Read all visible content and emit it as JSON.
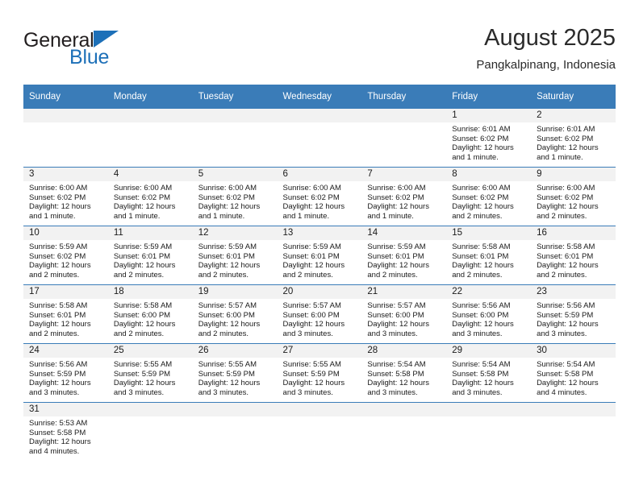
{
  "logo": {
    "word_primary": "General",
    "word_secondary": "Blue",
    "flag_icon": "triangle-flag-icon",
    "primary_color": "#231f20",
    "accent_color": "#1d70b8"
  },
  "header": {
    "title": "August 2025",
    "subtitle": "Pangkalpinang, Indonesia"
  },
  "theme": {
    "header_bg": "#3a7cb8",
    "header_text": "#ffffff",
    "daynum_band_bg": "#f2f2f2",
    "row_divider": "#3a7cb8",
    "body_text": "#1a1a1a"
  },
  "calendar": {
    "weekday_headers": [
      "Sunday",
      "Monday",
      "Tuesday",
      "Wednesday",
      "Thursday",
      "Friday",
      "Saturday"
    ],
    "weeks": [
      [
        {
          "day": "",
          "lines": []
        },
        {
          "day": "",
          "lines": []
        },
        {
          "day": "",
          "lines": []
        },
        {
          "day": "",
          "lines": []
        },
        {
          "day": "",
          "lines": []
        },
        {
          "day": "1",
          "lines": [
            "Sunrise: 6:01 AM",
            "Sunset: 6:02 PM",
            "Daylight: 12 hours",
            "and 1 minute."
          ]
        },
        {
          "day": "2",
          "lines": [
            "Sunrise: 6:01 AM",
            "Sunset: 6:02 PM",
            "Daylight: 12 hours",
            "and 1 minute."
          ]
        }
      ],
      [
        {
          "day": "3",
          "lines": [
            "Sunrise: 6:00 AM",
            "Sunset: 6:02 PM",
            "Daylight: 12 hours",
            "and 1 minute."
          ]
        },
        {
          "day": "4",
          "lines": [
            "Sunrise: 6:00 AM",
            "Sunset: 6:02 PM",
            "Daylight: 12 hours",
            "and 1 minute."
          ]
        },
        {
          "day": "5",
          "lines": [
            "Sunrise: 6:00 AM",
            "Sunset: 6:02 PM",
            "Daylight: 12 hours",
            "and 1 minute."
          ]
        },
        {
          "day": "6",
          "lines": [
            "Sunrise: 6:00 AM",
            "Sunset: 6:02 PM",
            "Daylight: 12 hours",
            "and 1 minute."
          ]
        },
        {
          "day": "7",
          "lines": [
            "Sunrise: 6:00 AM",
            "Sunset: 6:02 PM",
            "Daylight: 12 hours",
            "and 1 minute."
          ]
        },
        {
          "day": "8",
          "lines": [
            "Sunrise: 6:00 AM",
            "Sunset: 6:02 PM",
            "Daylight: 12 hours",
            "and 2 minutes."
          ]
        },
        {
          "day": "9",
          "lines": [
            "Sunrise: 6:00 AM",
            "Sunset: 6:02 PM",
            "Daylight: 12 hours",
            "and 2 minutes."
          ]
        }
      ],
      [
        {
          "day": "10",
          "lines": [
            "Sunrise: 5:59 AM",
            "Sunset: 6:02 PM",
            "Daylight: 12 hours",
            "and 2 minutes."
          ]
        },
        {
          "day": "11",
          "lines": [
            "Sunrise: 5:59 AM",
            "Sunset: 6:01 PM",
            "Daylight: 12 hours",
            "and 2 minutes."
          ]
        },
        {
          "day": "12",
          "lines": [
            "Sunrise: 5:59 AM",
            "Sunset: 6:01 PM",
            "Daylight: 12 hours",
            "and 2 minutes."
          ]
        },
        {
          "day": "13",
          "lines": [
            "Sunrise: 5:59 AM",
            "Sunset: 6:01 PM",
            "Daylight: 12 hours",
            "and 2 minutes."
          ]
        },
        {
          "day": "14",
          "lines": [
            "Sunrise: 5:59 AM",
            "Sunset: 6:01 PM",
            "Daylight: 12 hours",
            "and 2 minutes."
          ]
        },
        {
          "day": "15",
          "lines": [
            "Sunrise: 5:58 AM",
            "Sunset: 6:01 PM",
            "Daylight: 12 hours",
            "and 2 minutes."
          ]
        },
        {
          "day": "16",
          "lines": [
            "Sunrise: 5:58 AM",
            "Sunset: 6:01 PM",
            "Daylight: 12 hours",
            "and 2 minutes."
          ]
        }
      ],
      [
        {
          "day": "17",
          "lines": [
            "Sunrise: 5:58 AM",
            "Sunset: 6:01 PM",
            "Daylight: 12 hours",
            "and 2 minutes."
          ]
        },
        {
          "day": "18",
          "lines": [
            "Sunrise: 5:58 AM",
            "Sunset: 6:00 PM",
            "Daylight: 12 hours",
            "and 2 minutes."
          ]
        },
        {
          "day": "19",
          "lines": [
            "Sunrise: 5:57 AM",
            "Sunset: 6:00 PM",
            "Daylight: 12 hours",
            "and 2 minutes."
          ]
        },
        {
          "day": "20",
          "lines": [
            "Sunrise: 5:57 AM",
            "Sunset: 6:00 PM",
            "Daylight: 12 hours",
            "and 3 minutes."
          ]
        },
        {
          "day": "21",
          "lines": [
            "Sunrise: 5:57 AM",
            "Sunset: 6:00 PM",
            "Daylight: 12 hours",
            "and 3 minutes."
          ]
        },
        {
          "day": "22",
          "lines": [
            "Sunrise: 5:56 AM",
            "Sunset: 6:00 PM",
            "Daylight: 12 hours",
            "and 3 minutes."
          ]
        },
        {
          "day": "23",
          "lines": [
            "Sunrise: 5:56 AM",
            "Sunset: 5:59 PM",
            "Daylight: 12 hours",
            "and 3 minutes."
          ]
        }
      ],
      [
        {
          "day": "24",
          "lines": [
            "Sunrise: 5:56 AM",
            "Sunset: 5:59 PM",
            "Daylight: 12 hours",
            "and 3 minutes."
          ]
        },
        {
          "day": "25",
          "lines": [
            "Sunrise: 5:55 AM",
            "Sunset: 5:59 PM",
            "Daylight: 12 hours",
            "and 3 minutes."
          ]
        },
        {
          "day": "26",
          "lines": [
            "Sunrise: 5:55 AM",
            "Sunset: 5:59 PM",
            "Daylight: 12 hours",
            "and 3 minutes."
          ]
        },
        {
          "day": "27",
          "lines": [
            "Sunrise: 5:55 AM",
            "Sunset: 5:59 PM",
            "Daylight: 12 hours",
            "and 3 minutes."
          ]
        },
        {
          "day": "28",
          "lines": [
            "Sunrise: 5:54 AM",
            "Sunset: 5:58 PM",
            "Daylight: 12 hours",
            "and 3 minutes."
          ]
        },
        {
          "day": "29",
          "lines": [
            "Sunrise: 5:54 AM",
            "Sunset: 5:58 PM",
            "Daylight: 12 hours",
            "and 3 minutes."
          ]
        },
        {
          "day": "30",
          "lines": [
            "Sunrise: 5:54 AM",
            "Sunset: 5:58 PM",
            "Daylight: 12 hours",
            "and 4 minutes."
          ]
        }
      ],
      [
        {
          "day": "31",
          "lines": [
            "Sunrise: 5:53 AM",
            "Sunset: 5:58 PM",
            "Daylight: 12 hours",
            "and 4 minutes."
          ]
        },
        {
          "day": "",
          "lines": []
        },
        {
          "day": "",
          "lines": []
        },
        {
          "day": "",
          "lines": []
        },
        {
          "day": "",
          "lines": []
        },
        {
          "day": "",
          "lines": []
        },
        {
          "day": "",
          "lines": []
        }
      ]
    ]
  }
}
